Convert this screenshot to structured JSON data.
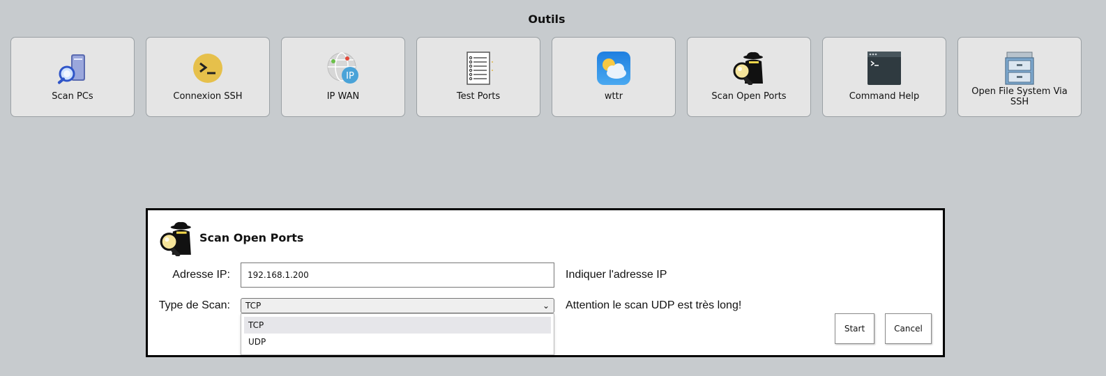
{
  "page": {
    "title": "Outils"
  },
  "tools": [
    {
      "label": "Scan PCs",
      "icon": "scan-pcs-icon"
    },
    {
      "label": "Connexion SSH",
      "icon": "ssh-terminal-icon"
    },
    {
      "label": "IP WAN",
      "icon": "ip-globe-icon"
    },
    {
      "label": "Test Ports",
      "icon": "checklist-icon"
    },
    {
      "label": "wttr",
      "icon": "weather-icon"
    },
    {
      "label": "Scan Open Ports",
      "icon": "spy-magnifier-icon"
    },
    {
      "label": "Command Help",
      "icon": "terminal-window-icon"
    },
    {
      "label": "Open File System Via SSH",
      "icon": "file-cabinet-icon"
    }
  ],
  "dialog": {
    "title": "Scan Open Ports",
    "icon": "spy-magnifier-icon",
    "ip_label": "Adresse IP:",
    "ip_value": "192.168.1.200",
    "ip_hint": "Indiquer l'adresse IP",
    "scan_label": "Type de Scan:",
    "scan_selected": "TCP",
    "scan_hint": "Attention le scan UDP est très long!",
    "scan_options": [
      "TCP",
      "UDP"
    ],
    "start_label": "Start",
    "cancel_label": "Cancel"
  }
}
